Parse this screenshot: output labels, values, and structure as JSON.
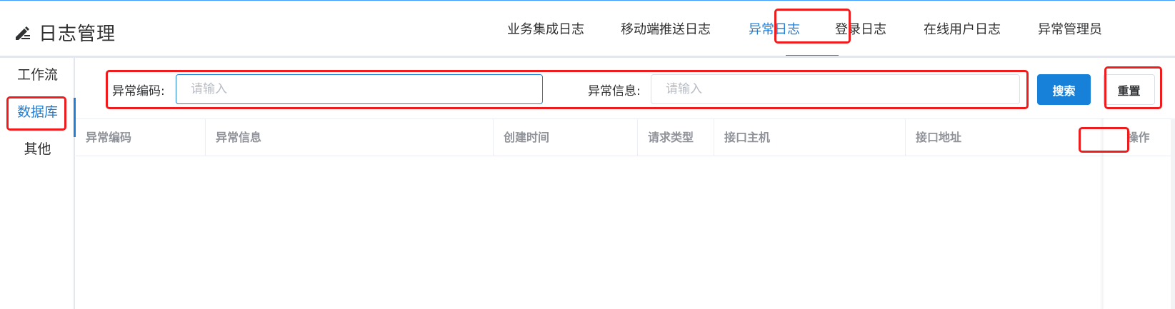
{
  "header": {
    "title": "日志管理",
    "icon": "edit-pen-icon",
    "nav": [
      {
        "label": "业务集成日志",
        "active": false
      },
      {
        "label": "移动端推送日志",
        "active": false
      },
      {
        "label": "异常日志",
        "active": true
      },
      {
        "label": "登录日志",
        "active": false
      },
      {
        "label": "在线用户日志",
        "active": false
      },
      {
        "label": "异常管理员",
        "active": false
      }
    ]
  },
  "sidebar": {
    "items": [
      {
        "label": "工作流",
        "active": false
      },
      {
        "label": "数据库",
        "active": true
      },
      {
        "label": "其他",
        "active": false
      }
    ]
  },
  "search": {
    "code_label": "异常编码:",
    "code_placeholder": "请输入",
    "code_value": "",
    "info_label": "异常信息:",
    "info_placeholder": "请输入",
    "info_value": "",
    "search_button": "搜索",
    "reset_button": "重置"
  },
  "table": {
    "columns": [
      "异常编码",
      "异常信息",
      "创建时间",
      "请求类型",
      "接口主机",
      "接口地址",
      "操作"
    ],
    "rows": []
  },
  "colors": {
    "accent": "#1f7ed6",
    "highlight": "#ee1c1c",
    "header_text": "#909399"
  }
}
